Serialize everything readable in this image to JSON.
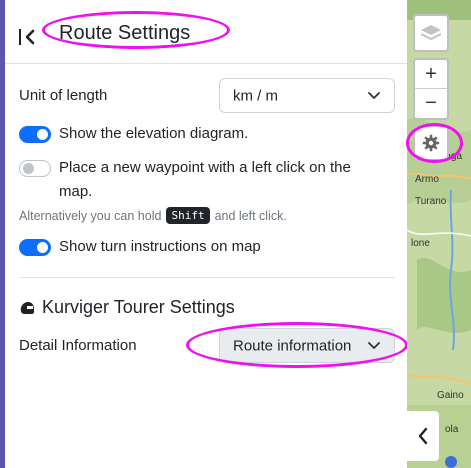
{
  "header": {
    "title": "Route Settings"
  },
  "unit": {
    "label": "Unit of length",
    "value": "km / m"
  },
  "toggles": {
    "elevation": {
      "label": "Show the elevation diagram.",
      "on": true
    },
    "waypoint": {
      "label": "Place a new waypoint with a left click on the map.",
      "on": false
    },
    "turn": {
      "label": "Show turn instructions on map",
      "on": true
    }
  },
  "hint": {
    "before": "Alternatively you can hold",
    "key": "Shift",
    "after": "and left click."
  },
  "kurviger": {
    "title": "Kurviger Tourer Settings",
    "detail_label": "Detail Information",
    "detail_value": "Route information"
  },
  "map": {
    "labels": [
      "Maga",
      "Armo",
      "Turano",
      "lone",
      "Gaino",
      "ola"
    ],
    "zoom_in": "+",
    "zoom_out": "−"
  },
  "colors": {
    "accent": "#0d6efd",
    "highlight": "#ee10ee",
    "edge": "#5b54b3"
  }
}
